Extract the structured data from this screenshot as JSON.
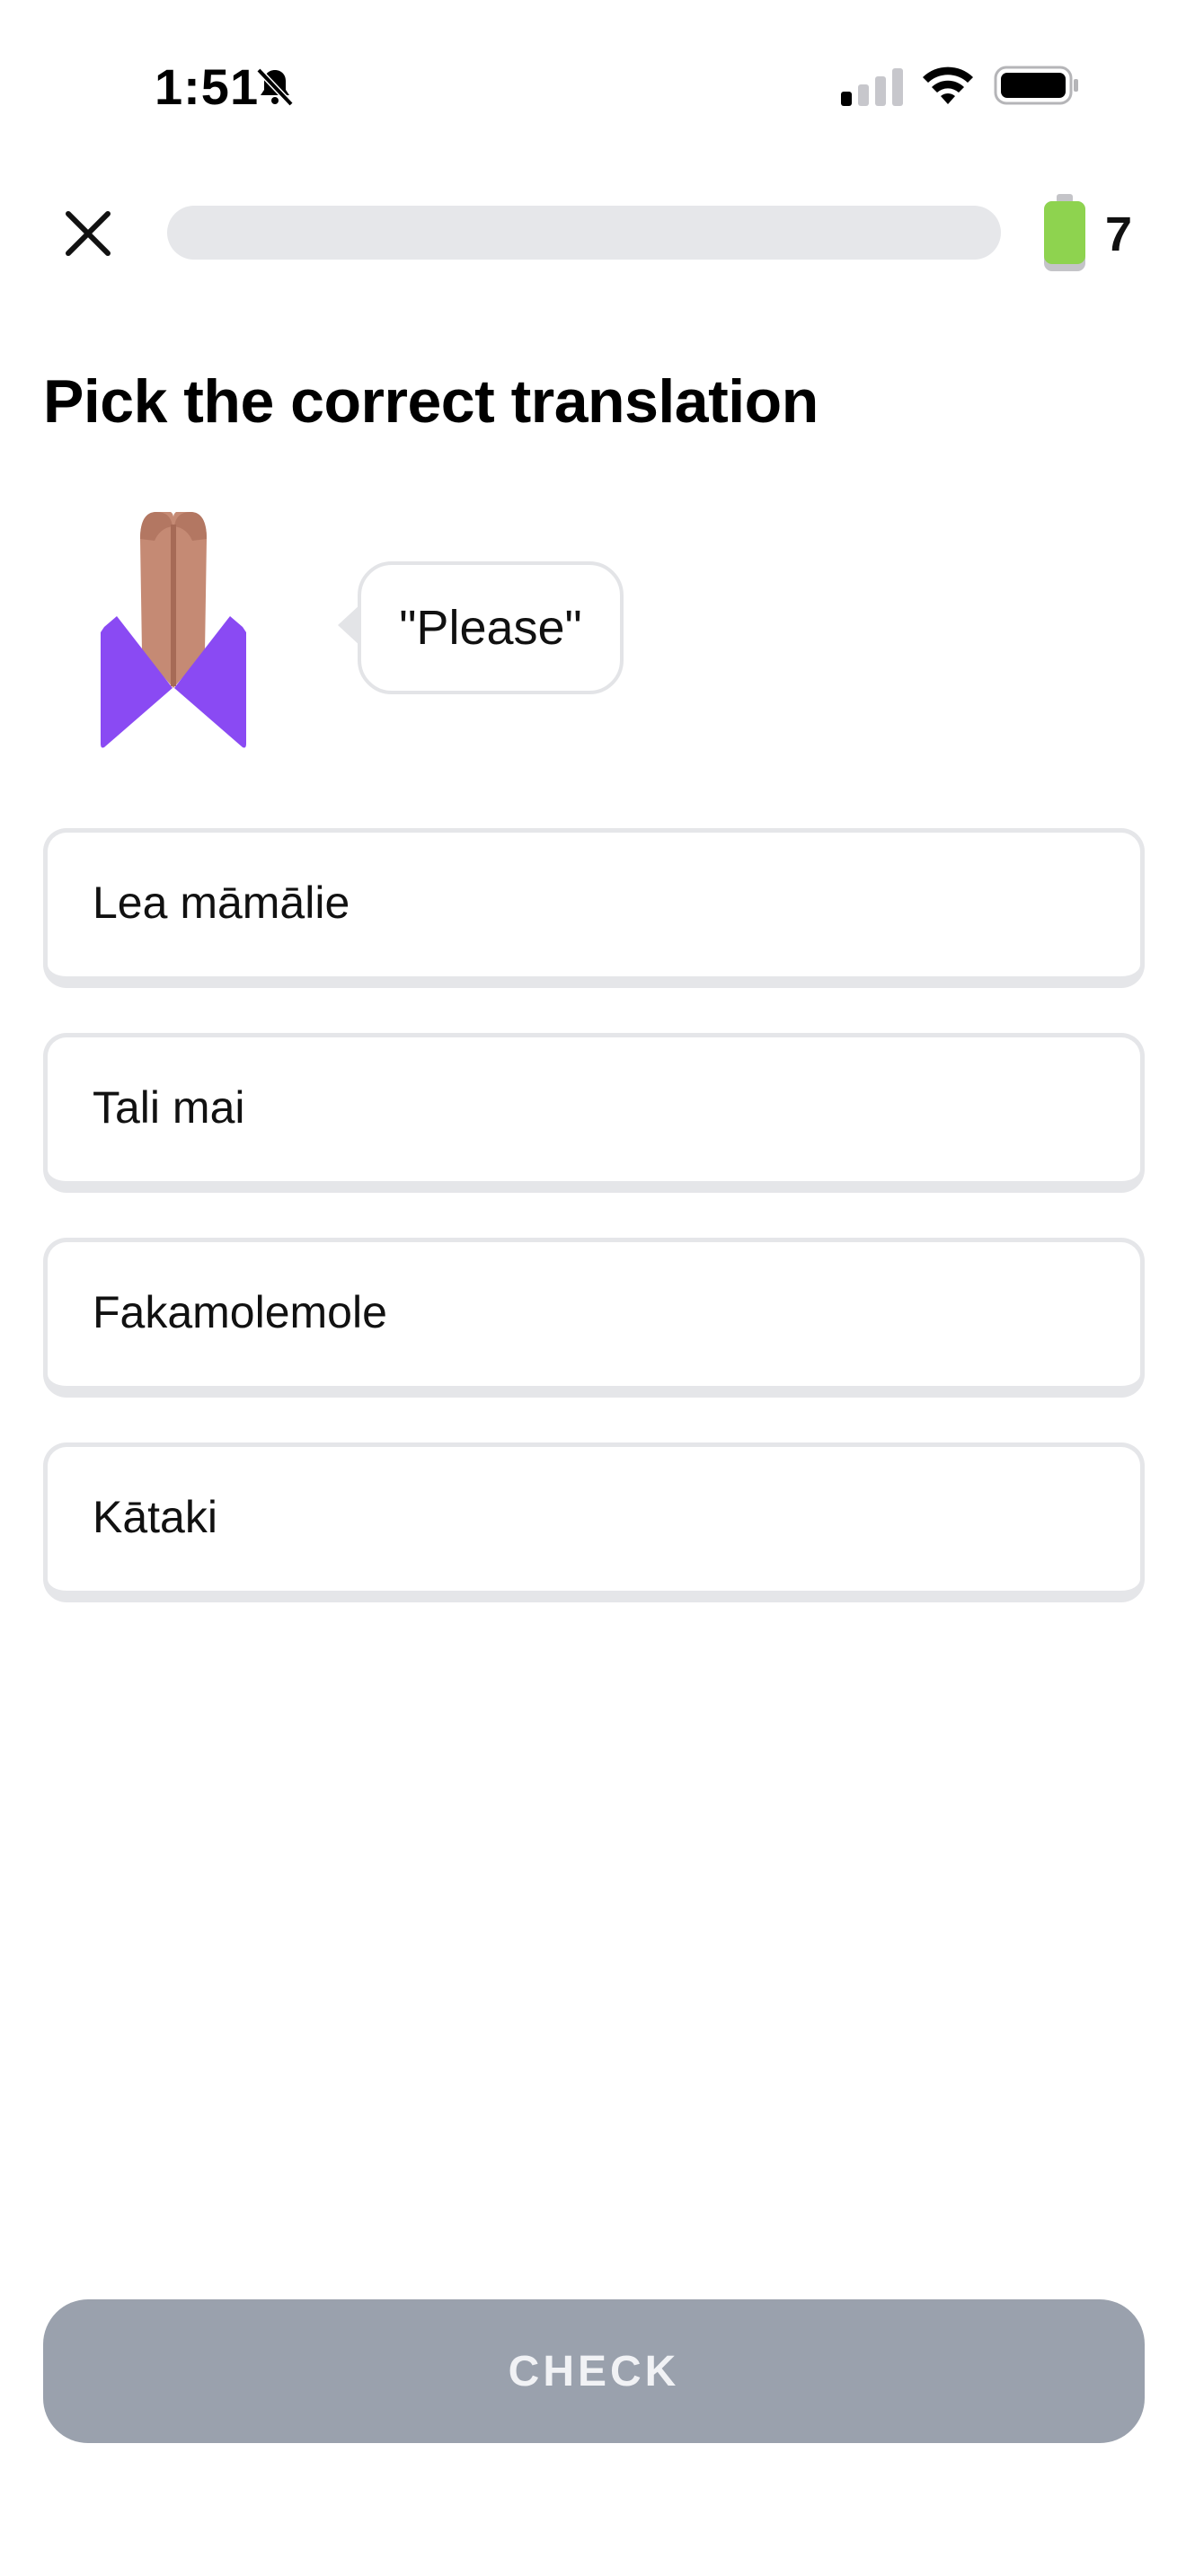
{
  "status_bar": {
    "time": "1:51",
    "icons": [
      "bell-slash-icon",
      "cellular-signal-icon",
      "wifi-icon",
      "battery-icon"
    ]
  },
  "top_bar": {
    "close_icon": "close-icon",
    "progress_fraction": 0.0,
    "energy_count": "7",
    "energy_icon": "battery-energy-icon"
  },
  "exercise": {
    "title": "Pick the correct translation",
    "prompt": "\"Please\"",
    "illustration": "praying-hands-icon"
  },
  "options": [
    {
      "label": "Lea māmālie"
    },
    {
      "label": "Tali mai"
    },
    {
      "label": "Fakamolemole"
    },
    {
      "label": "Kātaki"
    }
  ],
  "footer": {
    "check_label": "CHECK"
  },
  "colors": {
    "progress_track": "#e6e7ea",
    "energy_green": "#8ed34f",
    "sleeve_purple": "#8a4af3",
    "hand_skin": "#c58a74",
    "check_button_disabled": "#9aa1ad",
    "option_border": "#e5e6e9"
  }
}
